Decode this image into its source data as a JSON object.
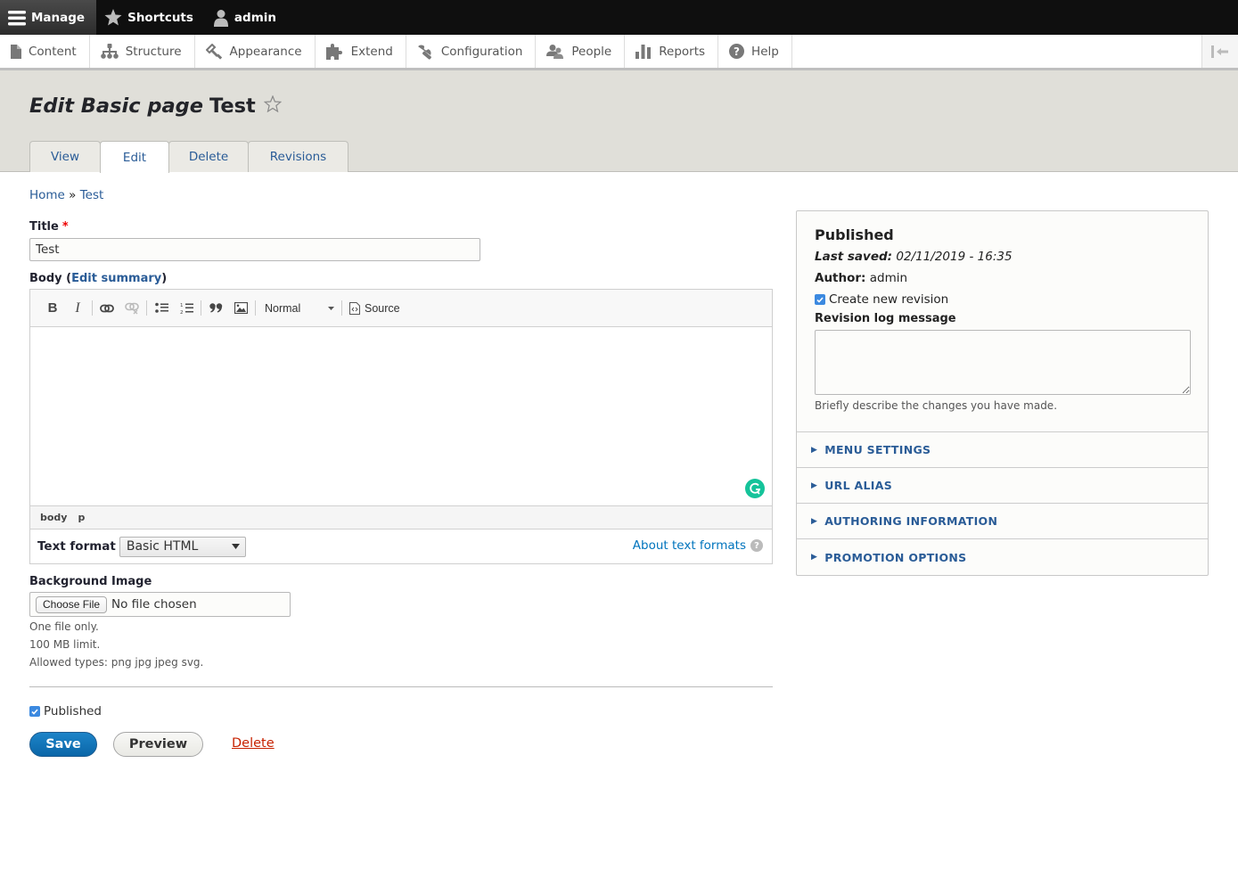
{
  "toolbar": {
    "manage": "Manage",
    "shortcuts": "Shortcuts",
    "user": "admin"
  },
  "tray": {
    "items": [
      {
        "label": "Content",
        "icon": "file-icon"
      },
      {
        "label": "Structure",
        "icon": "sitemap-icon"
      },
      {
        "label": "Appearance",
        "icon": "paintbrush-icon"
      },
      {
        "label": "Extend",
        "icon": "puzzle-icon"
      },
      {
        "label": "Configuration",
        "icon": "wrench-icon"
      },
      {
        "label": "People",
        "icon": "people-icon"
      },
      {
        "label": "Reports",
        "icon": "bar-chart-icon"
      },
      {
        "label": "Help",
        "icon": "help-icon"
      }
    ],
    "orientation_toggle": "collapse-arrow-icon"
  },
  "header": {
    "title_italic": "Edit Basic page",
    "title_node": "Test",
    "tabs": [
      {
        "label": "View",
        "active": false
      },
      {
        "label": "Edit",
        "active": true
      },
      {
        "label": "Delete",
        "active": false
      },
      {
        "label": "Revisions",
        "active": false
      }
    ]
  },
  "breadcrumb": {
    "home": "Home",
    "separator": "»",
    "current": "Test"
  },
  "form": {
    "title_label": "Title",
    "required_mark": "*",
    "title_value": "Test",
    "body_label": "Body",
    "body_open": "(",
    "edit_summary": "Edit summary",
    "body_close": ")",
    "editor": {
      "toolbar": {
        "bold": "B",
        "italic": "I",
        "paragraph_format": "Normal",
        "source": "Source"
      },
      "path": [
        "body",
        "p"
      ],
      "text_format_label": "Text format",
      "text_format_value": "Basic HTML",
      "about_text_formats": "About text formats",
      "help_mark": "?"
    },
    "background_image_label": "Background Image",
    "choose_file": "Choose File",
    "no_file": "No file chosen",
    "file_help": [
      "One file only.",
      "100 MB limit.",
      "Allowed types: png jpg jpeg svg."
    ],
    "published_label": "Published",
    "published_checked": true,
    "actions": {
      "save": "Save",
      "preview": "Preview",
      "delete": "Delete"
    }
  },
  "sidebar": {
    "status": "Published",
    "last_saved_label": "Last saved:",
    "last_saved_value": "02/11/2019 - 16:35",
    "author_label": "Author:",
    "author_value": "admin",
    "create_revision_label": "Create new revision",
    "create_revision_checked": true,
    "revision_log_label": "Revision log message",
    "revision_log_value": "",
    "revision_log_help": "Briefly describe the changes you have made.",
    "sections": [
      "MENU SETTINGS",
      "URL ALIAS",
      "AUTHORING INFORMATION",
      "PROMOTION OPTIONS"
    ]
  },
  "colors": {
    "link": "#2a5c97",
    "primary_button": "#0a66a8",
    "danger": "#c72100",
    "checkbox": "#3b89e0",
    "grammarly": "#15c39a"
  }
}
